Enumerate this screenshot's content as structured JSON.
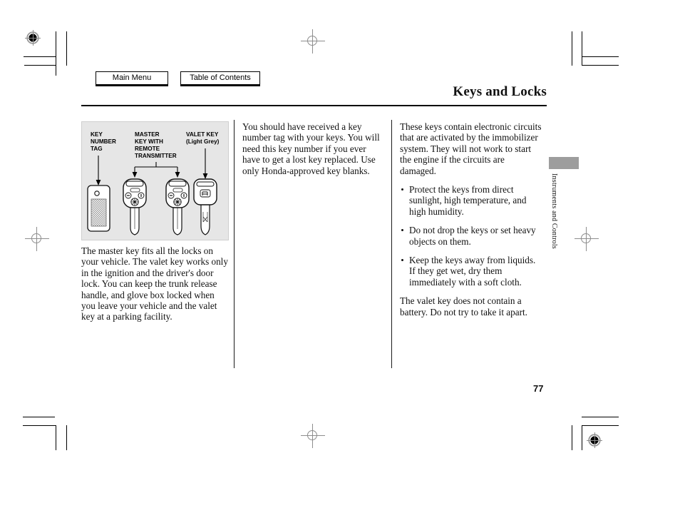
{
  "nav": {
    "main_menu_label": "Main Menu",
    "table_of_contents_label": "Table of Contents"
  },
  "header": {
    "title": "Keys and Locks"
  },
  "figure": {
    "labels": {
      "key_number_tag": [
        "KEY",
        "NUMBER",
        "TAG"
      ],
      "master_key": [
        "MASTER",
        "KEY WITH",
        "REMOTE",
        "TRANSMITTER"
      ],
      "valet_key": [
        "VALET KEY",
        "(Light Grey)"
      ]
    },
    "items": [
      "key-number-tag",
      "master-key-with-remote-transmitter-1",
      "master-key-with-remote-transmitter-2",
      "valet-key"
    ],
    "background_color": "#e6e6e6"
  },
  "columns": {
    "left": {
      "paragraphs": [
        "The master key fits all the locks on your vehicle. The valet key works only in the ignition and the driver's door lock. You can keep the trunk release handle, and glove box locked when you leave your vehicle and the valet key at a parking facility."
      ]
    },
    "middle": {
      "paragraphs": [
        "You should have received a key number tag with your keys. You will need this key number if you ever have to get a lost key replaced. Use only Honda-approved key blanks."
      ]
    },
    "right": {
      "intro": "These keys contain electronic circuits that are activated by the immobilizer system. They will not work to start the engine if the circuits are damaged.",
      "bullets": [
        "Protect the keys from direct sunlight, high temperature, and high humidity.",
        "Do not drop the keys or set heavy objects on them.",
        "Keep the keys away from liquids. If they get wet, dry them immediately with a soft cloth."
      ],
      "closing": "The valet key does not contain a battery. Do not try to take it apart."
    }
  },
  "side_tab": {
    "label": "Instruments and Controls",
    "block_color": "#9d9d9d"
  },
  "footer": {
    "page_number": "77"
  }
}
